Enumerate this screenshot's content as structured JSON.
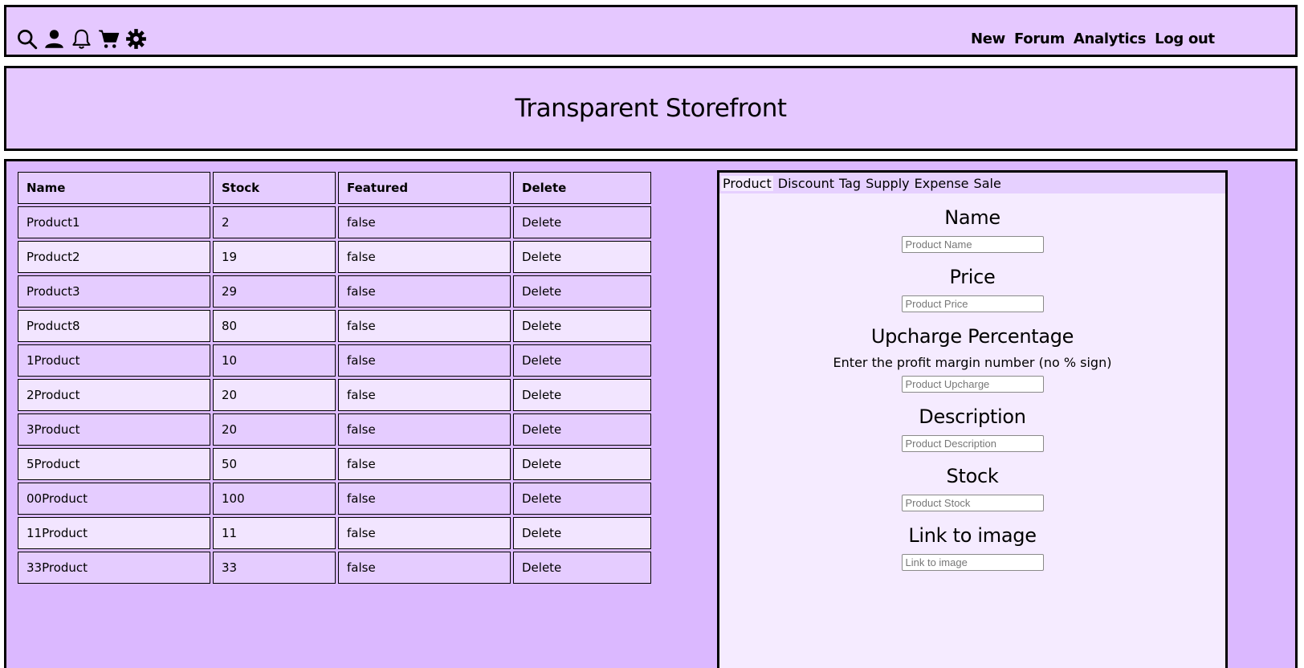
{
  "toolbar": {
    "icons": [
      "search-icon",
      "user-icon",
      "bell-icon",
      "cart-icon",
      "gear-icon"
    ]
  },
  "nav": {
    "items": [
      "New",
      "Forum",
      "Analytics",
      "Log out"
    ]
  },
  "header": {
    "title": "Transparent Storefront"
  },
  "table": {
    "columns": [
      "Name",
      "Stock",
      "Featured",
      "Delete"
    ],
    "rows": [
      {
        "name": "Product1",
        "stock": "2",
        "featured": "false",
        "delete": "Delete"
      },
      {
        "name": "Product2",
        "stock": "19",
        "featured": "false",
        "delete": "Delete"
      },
      {
        "name": "Product3",
        "stock": "29",
        "featured": "false",
        "delete": "Delete"
      },
      {
        "name": "Product8",
        "stock": "80",
        "featured": "false",
        "delete": "Delete"
      },
      {
        "name": "1Product",
        "stock": "10",
        "featured": "false",
        "delete": "Delete"
      },
      {
        "name": "2Product",
        "stock": "20",
        "featured": "false",
        "delete": "Delete"
      },
      {
        "name": "3Product",
        "stock": "20",
        "featured": "false",
        "delete": "Delete"
      },
      {
        "name": "5Product",
        "stock": "50",
        "featured": "false",
        "delete": "Delete"
      },
      {
        "name": "00Product",
        "stock": "100",
        "featured": "false",
        "delete": "Delete"
      },
      {
        "name": "11Product",
        "stock": "11",
        "featured": "false",
        "delete": "Delete"
      },
      {
        "name": "33Product",
        "stock": "33",
        "featured": "false",
        "delete": "Delete"
      }
    ]
  },
  "form": {
    "tabs": [
      "Product",
      "Discount",
      "Tag",
      "Supply",
      "Expense",
      "Sale"
    ],
    "active_tab": "Product",
    "fields": {
      "name": {
        "label": "Name",
        "placeholder": "Product Name",
        "value": ""
      },
      "price": {
        "label": "Price",
        "placeholder": "Product Price",
        "value": ""
      },
      "upcharge": {
        "label": "Upcharge Percentage",
        "help": "Enter the profit margin number (no % sign)",
        "placeholder": "Product Upcharge",
        "value": ""
      },
      "description": {
        "label": "Description",
        "placeholder": "Product Description",
        "value": ""
      },
      "stock": {
        "label": "Stock",
        "placeholder": "Product Stock",
        "value": ""
      },
      "image": {
        "label": "Link to image",
        "placeholder": "Link to image",
        "value": ""
      }
    }
  },
  "colors": {
    "header_bg": "#e5c8ff",
    "main_bg": "#dbb8ff",
    "row_odd": "#e5ccff",
    "row_even": "#f2e5ff",
    "panel_bg": "#f5ebff"
  }
}
